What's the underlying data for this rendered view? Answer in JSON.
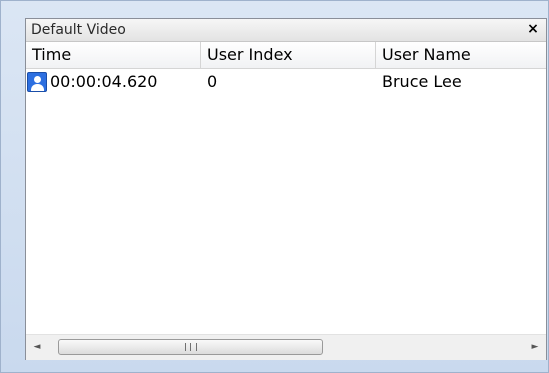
{
  "panel": {
    "title": "Default Video",
    "close_label": "×"
  },
  "columns": [
    "Time",
    "User Index",
    "User Name"
  ],
  "rows": [
    {
      "time": "00:00:04.620",
      "user_index": "0",
      "user_name": "Bruce Lee",
      "icon": "user-icon"
    }
  ],
  "scrollbar": {
    "left_arrow": "◄",
    "right_arrow": "►"
  }
}
